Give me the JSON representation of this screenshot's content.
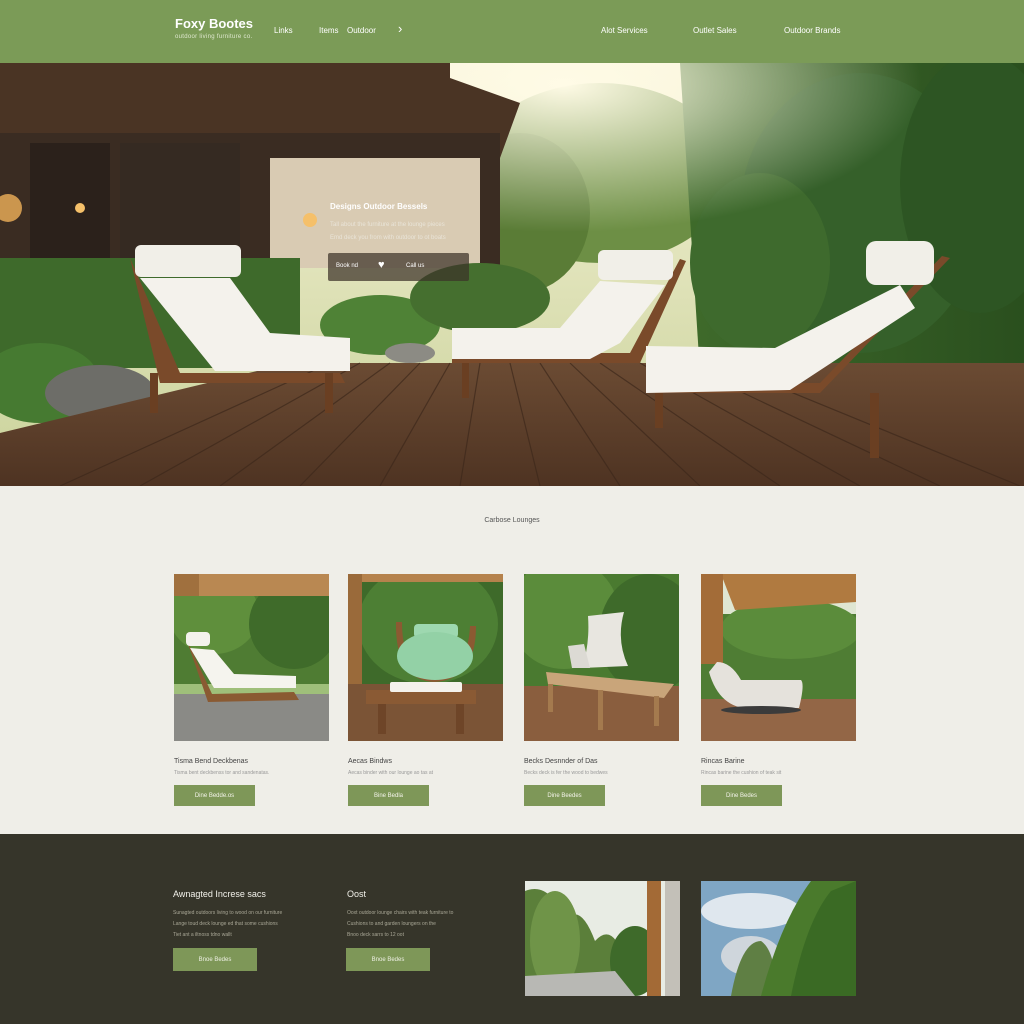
{
  "header": {
    "brand": "Foxy Bootes",
    "tagline": "outdoor living furniture co.",
    "nav_left": [
      "Links",
      "Items",
      "Outdoor"
    ],
    "nav_right": [
      "Alot Services",
      "Outlet Sales",
      "Outdoor Brands"
    ]
  },
  "hero": {
    "title": "Designs Outdoor Bessels",
    "subtitle_1": "Tall about the furniture at the lounge pieces",
    "subtitle_2": "Emd deck you from with outdoor to ot boats",
    "pill_left": "Book nd",
    "pill_right": "Call us"
  },
  "products": {
    "section_title": "Carbose Lounges",
    "cards": [
      {
        "title": "Tisma Bend Deckbenas",
        "desc": "Tisma bent deckbenss tor and sandenatas.",
        "button": "Dine Bedde.os"
      },
      {
        "title": "Aecas Bindws",
        "desc": "Aecas binder with our lounge ao tas at",
        "button": "Bine Bedla"
      },
      {
        "title": "Becks Desnnder of Das",
        "desc": "Becks deck is fer the wood to bedwes",
        "button": "Dine Beedes"
      },
      {
        "title": "Rincas Barine",
        "desc": "Rincas barine the cushion of teak sit",
        "button": "Dine Bedes"
      }
    ]
  },
  "footer": {
    "col1_title": "Awnagted Increse sacs",
    "col1_lines": [
      "Sunagted outdoors living to wood on our furniture",
      "Lange toud deck lounge ed that some cushions",
      "Tiet ant a iltnoss tdno wallt"
    ],
    "col1_button": "Bnoe Bedes",
    "col2_title": "Oost",
    "col2_lines": [
      "Ooxt outdoor lounge chairs with teak furniture to",
      "Cushions to and garden loungers on the",
      "Bnoo deck sarrs to 12 oot"
    ],
    "col2_button": "Bnoe Bedes"
  },
  "colors": {
    "header_green": "#7b9b57",
    "button_green": "#7e9758",
    "footer_dark": "#36352a",
    "page_bg": "#efeee8"
  }
}
